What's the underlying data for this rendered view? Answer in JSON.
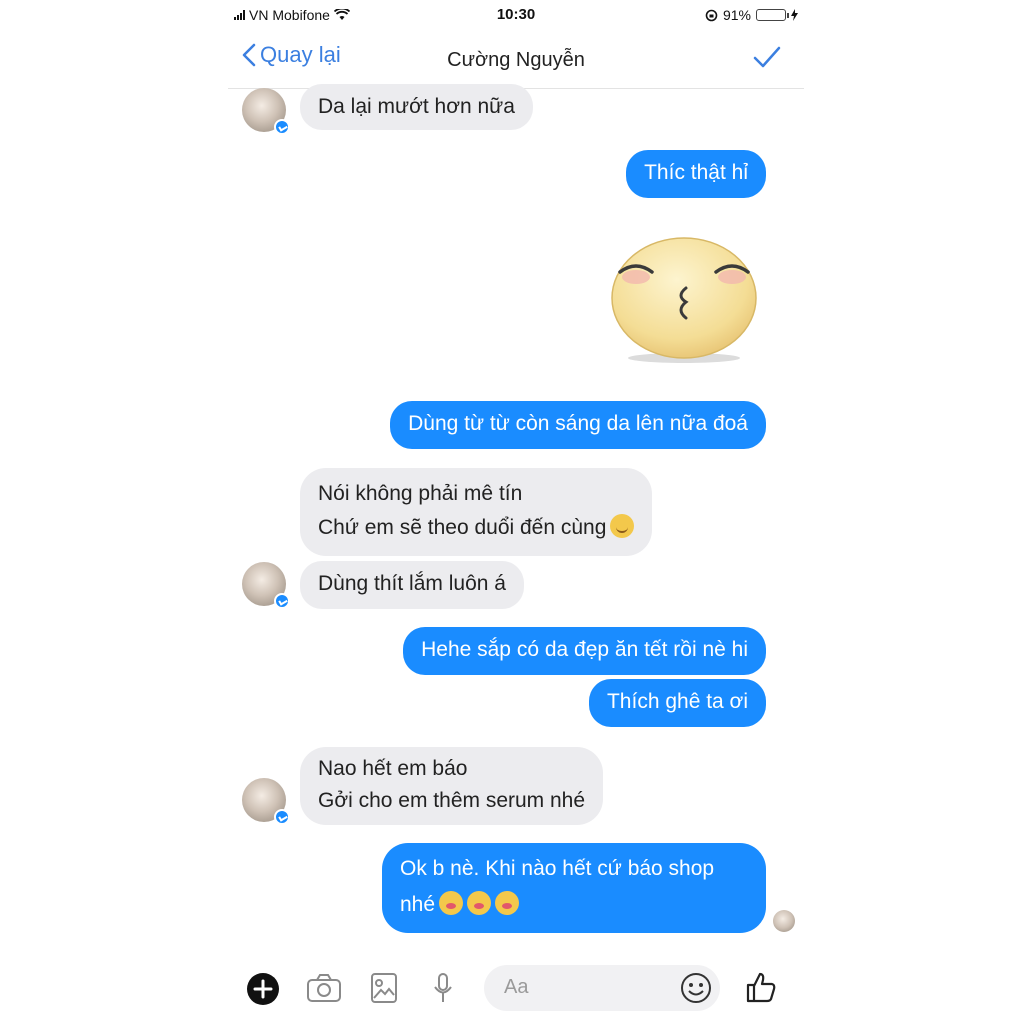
{
  "status_bar": {
    "carrier": "VN Mobifone",
    "time": "10:30",
    "battery": "91%",
    "battery_level": 0.91
  },
  "nav": {
    "back_label": "Quay lại",
    "title": "Cường Nguyễn"
  },
  "messages": [
    {
      "from": "them",
      "lines": [
        "Da lại mướt hơn nữa"
      ]
    },
    {
      "from": "me",
      "lines": [
        "Thíc thật hỉ"
      ]
    },
    {
      "from": "me",
      "type": "sticker",
      "sticker": "kissing-face-sticker"
    },
    {
      "from": "me",
      "lines": [
        "Dùng từ từ còn sáng da lên nữa đoá"
      ]
    },
    {
      "from": "them",
      "lines": [
        "Nói không phải mê tín",
        "Chứ em sẽ theo duổi đến cùng"
      ],
      "emoji": [
        "smile"
      ]
    },
    {
      "from": "them",
      "lines": [
        "Dùng thít lắm luôn á"
      ]
    },
    {
      "from": "me",
      "lines": [
        "Hehe sắp có da đẹp ăn tết rồi nè hi"
      ]
    },
    {
      "from": "me",
      "lines": [
        "Thích ghê ta ơi"
      ]
    },
    {
      "from": "them",
      "lines": [
        "Nao hết em báo",
        "Gởi cho em thêm serum nhé"
      ]
    },
    {
      "from": "me",
      "lines": [
        "Ok b nè. Khi nào hết cứ báo shop",
        "nhé"
      ],
      "emoji": [
        "kiss",
        "kiss",
        "kiss"
      ]
    }
  ],
  "composer": {
    "placeholder": "Aa"
  },
  "colors": {
    "accent": "#1a8cff",
    "incoming_bubble": "#ececef",
    "nav_accent": "#3b7fe0"
  }
}
